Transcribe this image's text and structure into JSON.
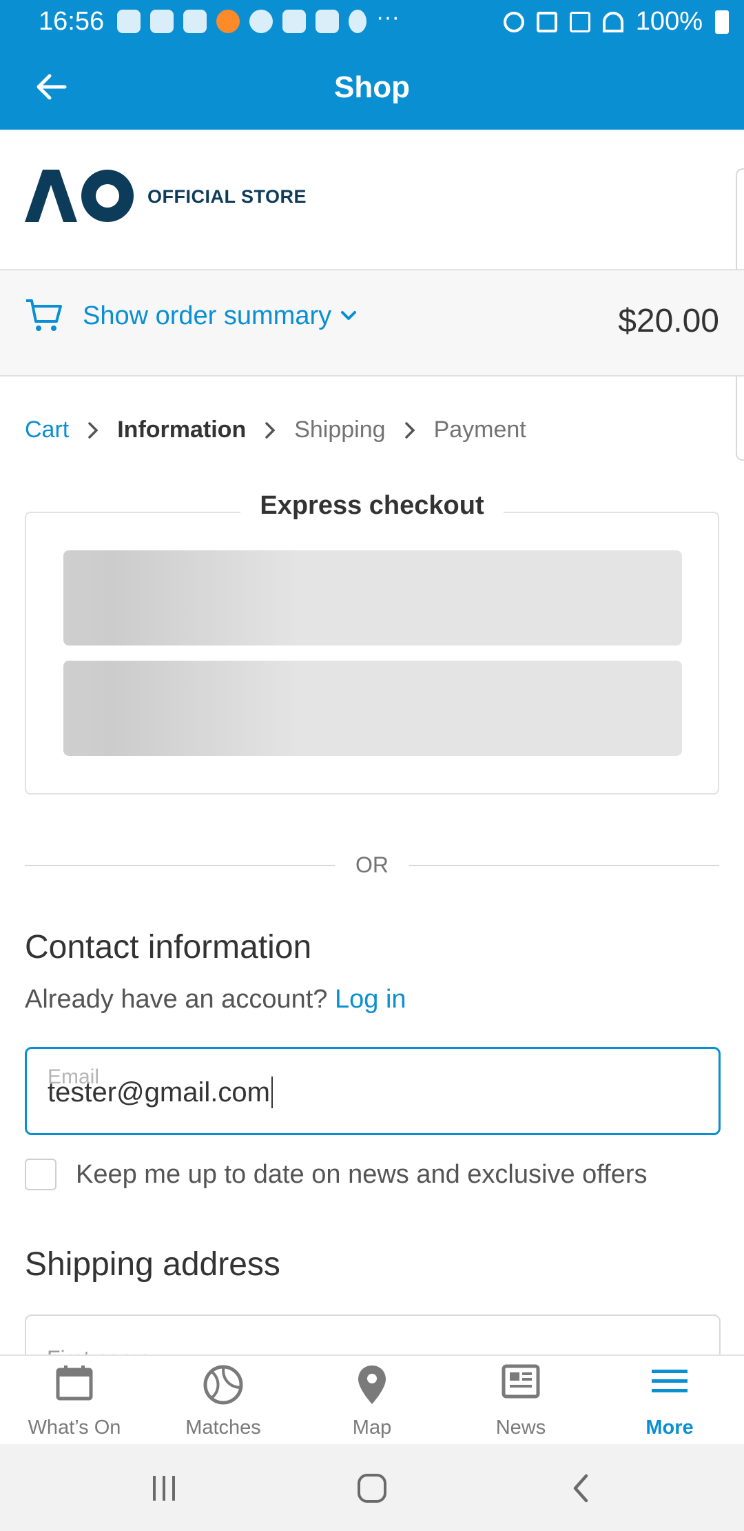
{
  "status_bar": {
    "time": "16:56",
    "battery": "100%",
    "notification_icons": [
      "games-icon",
      "instagram-icon",
      "outlook-icon",
      "firefox-icon",
      "spotify-icon",
      "tasks-icon",
      "gmail-icon",
      "accessibility-icon"
    ]
  },
  "app_bar": {
    "title": "Shop"
  },
  "store": {
    "logo_text": "AO",
    "name": "OFFICIAL STORE"
  },
  "summary": {
    "toggle_label": "Show order summary",
    "total": "$20.00"
  },
  "breadcrumb": [
    {
      "label": "Cart",
      "state": "link"
    },
    {
      "label": "Information",
      "state": "current"
    },
    {
      "label": "Shipping",
      "state": "future"
    },
    {
      "label": "Payment",
      "state": "future"
    }
  ],
  "express": {
    "title": "Express checkout"
  },
  "divider": {
    "text": "OR"
  },
  "contact": {
    "title": "Contact information",
    "account_prompt": "Already have an account?",
    "login_label": "Log in",
    "email_label": "Email",
    "email_value": "tester@gmail.com",
    "newsletter_label": "Keep me up to date on news and exclusive offers",
    "newsletter_checked": false
  },
  "shipping": {
    "title": "Shipping address",
    "first_name_label": "First name"
  },
  "bottom_nav": [
    {
      "label": "What’s On",
      "icon": "calendar-icon",
      "active": false
    },
    {
      "label": "Matches",
      "icon": "tennis-ball-icon",
      "active": false
    },
    {
      "label": "Map",
      "icon": "map-pin-icon",
      "active": false
    },
    {
      "label": "News",
      "icon": "news-icon",
      "active": false
    },
    {
      "label": "More",
      "icon": "menu-icon",
      "active": true
    }
  ],
  "colors": {
    "accent": "#0a8fd3",
    "brand_navy": "#0d3b5a",
    "text": "#333333",
    "muted": "#737373"
  }
}
